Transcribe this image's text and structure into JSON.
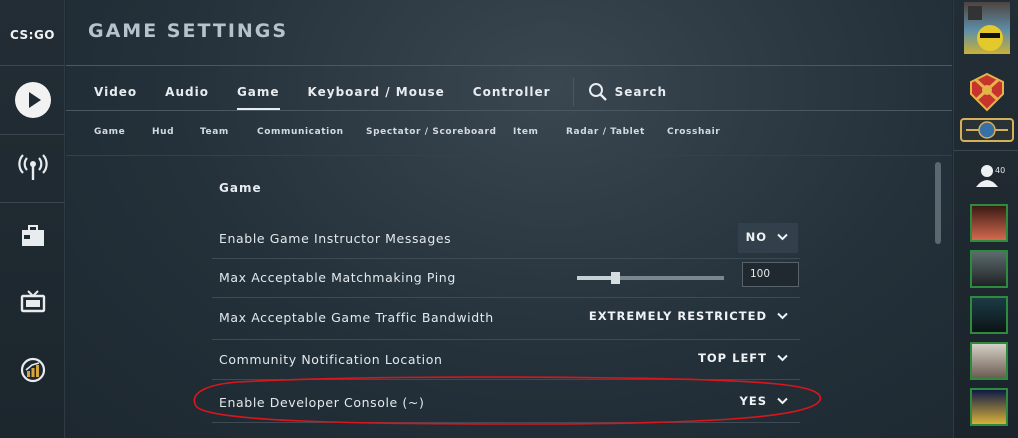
{
  "app": {
    "logo": "CS:GO"
  },
  "header": {
    "title": "GAME SETTINGS"
  },
  "tabs": [
    {
      "label": "Video"
    },
    {
      "label": "Audio"
    },
    {
      "label": "Game"
    },
    {
      "label": "Keyboard / Mouse"
    },
    {
      "label": "Controller"
    }
  ],
  "active_tab": "Game",
  "search": {
    "label": "Search"
  },
  "subtabs": [
    "Game",
    "Hud",
    "Team",
    "Communication",
    "Spectator / Scoreboard",
    "Item",
    "Radar / Tablet",
    "Crosshair"
  ],
  "section": {
    "title": "Game"
  },
  "settings": [
    {
      "label": "Enable Game Instructor Messages",
      "value": "NO"
    },
    {
      "label": "Max Acceptable Matchmaking Ping",
      "value": "100",
      "slider_fraction": 0.26
    },
    {
      "label": "Max Acceptable Game Traffic Bandwidth",
      "value": "EXTREMELY RESTRICTED"
    },
    {
      "label": "Community Notification Location",
      "value": "TOP LEFT"
    },
    {
      "label": "Enable Developer Console (~)",
      "value": "YES"
    }
  ],
  "friends": {
    "count": "40"
  },
  "colors": {
    "accent": "#e6ecef",
    "annotation": "#d8161c",
    "online": "#2e8b3d"
  }
}
